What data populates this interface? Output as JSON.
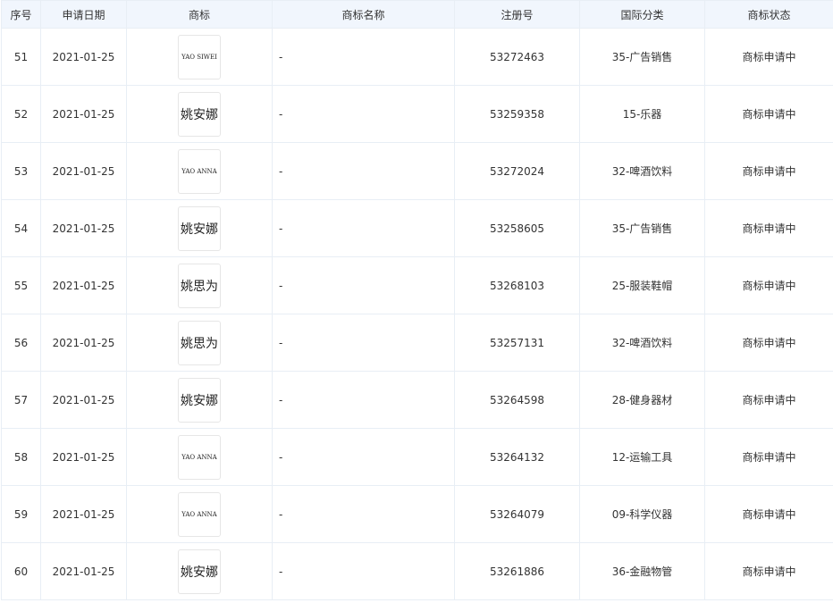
{
  "table": {
    "headers": [
      "序号",
      "申请日期",
      "商标",
      "商标名称",
      "注册号",
      "国际分类",
      "商标状态"
    ],
    "rows": [
      {
        "index": "51",
        "date": "2021-01-25",
        "logo_text": "YAO SIWEI",
        "logo_lang": "en",
        "name": "-",
        "reg_no": "53272463",
        "class": "35-广告销售",
        "status": "商标申请中"
      },
      {
        "index": "52",
        "date": "2021-01-25",
        "logo_text": "姚安娜",
        "logo_lang": "cn",
        "name": "-",
        "reg_no": "53259358",
        "class": "15-乐器",
        "status": "商标申请中"
      },
      {
        "index": "53",
        "date": "2021-01-25",
        "logo_text": "YAO ANNA",
        "logo_lang": "en",
        "name": "-",
        "reg_no": "53272024",
        "class": "32-啤酒饮料",
        "status": "商标申请中"
      },
      {
        "index": "54",
        "date": "2021-01-25",
        "logo_text": "姚安娜",
        "logo_lang": "cn",
        "name": "-",
        "reg_no": "53258605",
        "class": "35-广告销售",
        "status": "商标申请中"
      },
      {
        "index": "55",
        "date": "2021-01-25",
        "logo_text": "姚思为",
        "logo_lang": "cn",
        "name": "-",
        "reg_no": "53268103",
        "class": "25-服装鞋帽",
        "status": "商标申请中"
      },
      {
        "index": "56",
        "date": "2021-01-25",
        "logo_text": "姚思为",
        "logo_lang": "cn",
        "name": "-",
        "reg_no": "53257131",
        "class": "32-啤酒饮料",
        "status": "商标申请中"
      },
      {
        "index": "57",
        "date": "2021-01-25",
        "logo_text": "姚安娜",
        "logo_lang": "cn",
        "name": "-",
        "reg_no": "53264598",
        "class": "28-健身器材",
        "status": "商标申请中"
      },
      {
        "index": "58",
        "date": "2021-01-25",
        "logo_text": "YAO ANNA",
        "logo_lang": "en",
        "name": "-",
        "reg_no": "53264132",
        "class": "12-运输工具",
        "status": "商标申请中"
      },
      {
        "index": "59",
        "date": "2021-01-25",
        "logo_text": "YAO ANNA",
        "logo_lang": "en",
        "name": "-",
        "reg_no": "53264079",
        "class": "09-科学仪器",
        "status": "商标申请中"
      },
      {
        "index": "60",
        "date": "2021-01-25",
        "logo_text": "姚安娜",
        "logo_lang": "cn",
        "name": "-",
        "reg_no": "53261886",
        "class": "36-金融物管",
        "status": "商标申请中"
      }
    ]
  }
}
